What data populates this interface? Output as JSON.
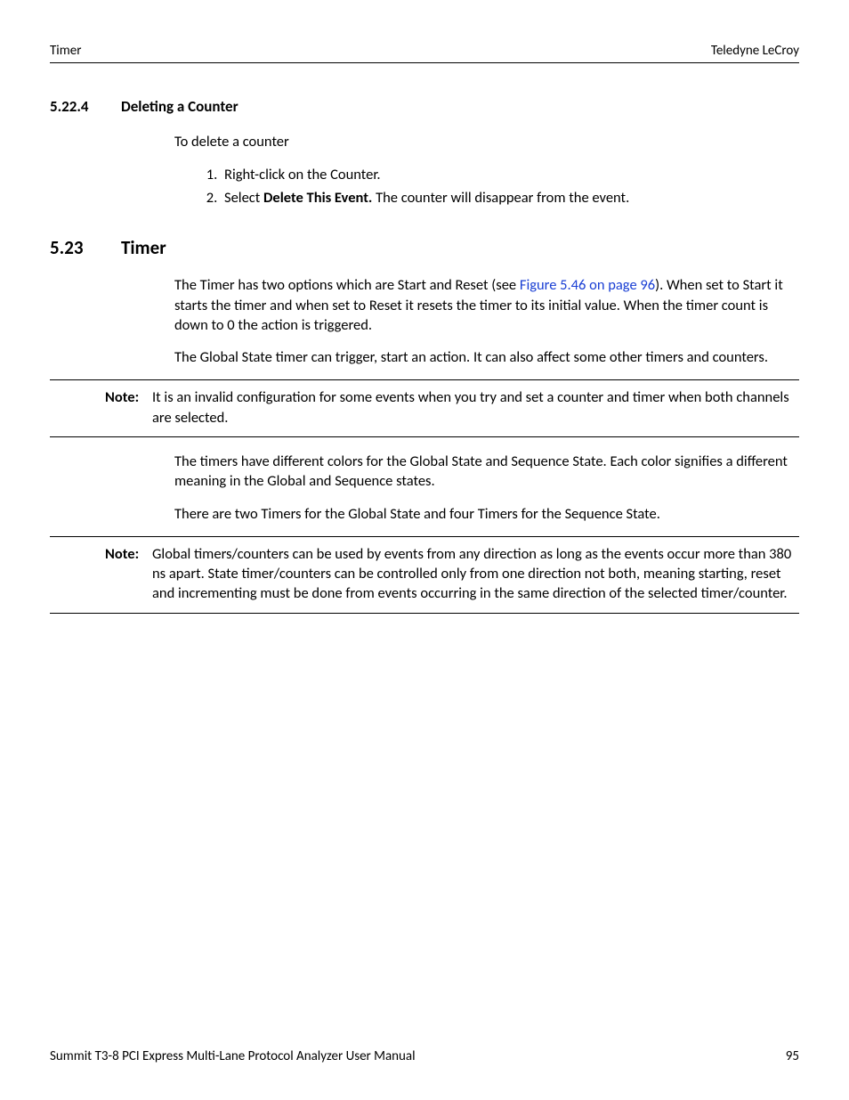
{
  "header": {
    "left": "Timer",
    "right": "Teledyne LeCroy"
  },
  "sec5224": {
    "num": "5.22.4",
    "title": "Deleting a Counter",
    "intro": "To delete a counter",
    "step1": "Right-click on the Counter.",
    "step2a": "Select ",
    "step2b": "Delete This Event.",
    "step2c": " The counter will disappear from the event."
  },
  "sec523": {
    "num": "5.23",
    "title": "Timer",
    "p1a": "The Timer has two options which are Start and Reset (see ",
    "p1link": "Figure 5.46 on page 96",
    "p1b": "). When set to Start it starts the timer and when set to Reset it resets the timer to its initial value. When the timer count is down to 0 the action is triggered.",
    "p2": "The Global State timer can trigger, start an action. It can also affect some other timers and counters.",
    "note1_label": "Note:",
    "note1_text": "It is an invalid configuration for some events when you try and set a counter and timer when both channels are selected.",
    "p3": "The timers have different colors for the Global State and Sequence State. Each color signifies a different meaning in the Global and Sequence states.",
    "p4": "There are two Timers for the Global State and four Timers for the Sequence State.",
    "note2_label": "Note:",
    "note2_text": "Global timers/counters can be used by events from any direction as long as the events occur more than 380 ns apart. State timer/counters can be controlled only from one direction not both, meaning starting, reset and incrementing must be done from events occurring in the same direction of the selected timer/counter."
  },
  "footer": {
    "left": "Summit T3-8 PCI Express Multi-Lane Protocol Analyzer User Manual",
    "right": "95"
  }
}
